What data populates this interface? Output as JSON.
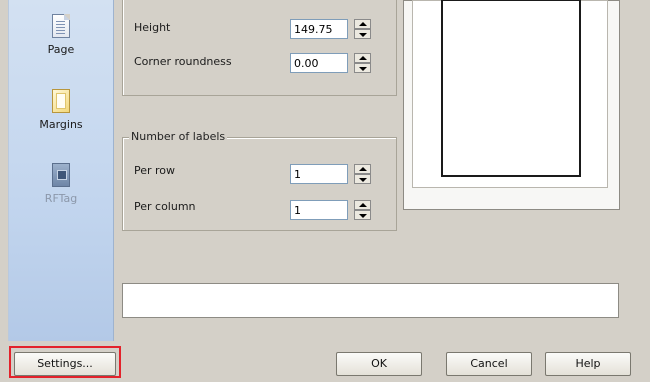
{
  "sidebar": {
    "items": [
      {
        "label": "Page",
        "icon": "page-icon",
        "enabled": true
      },
      {
        "label": "Margins",
        "icon": "margins-icon",
        "enabled": true
      },
      {
        "label": "RFTag",
        "icon": "rftag-icon",
        "enabled": false
      }
    ]
  },
  "dimensions": {
    "height": {
      "label": "Height",
      "value": "149.75"
    },
    "corner_roundness": {
      "label": "Corner roundness",
      "value": "0.00"
    }
  },
  "number_of_labels": {
    "legend": "Number of labels",
    "per_row": {
      "label": "Per row",
      "value": "1"
    },
    "per_column": {
      "label": "Per column",
      "value": "1"
    }
  },
  "footer": {
    "settings_label": "Settings...",
    "ok_label": "OK",
    "cancel_label": "Cancel",
    "help_label": "Help"
  },
  "colors": {
    "highlight": "#e3222b",
    "sidebar": "#c2d5ee",
    "dialog_bg": "#d4d0c8"
  }
}
